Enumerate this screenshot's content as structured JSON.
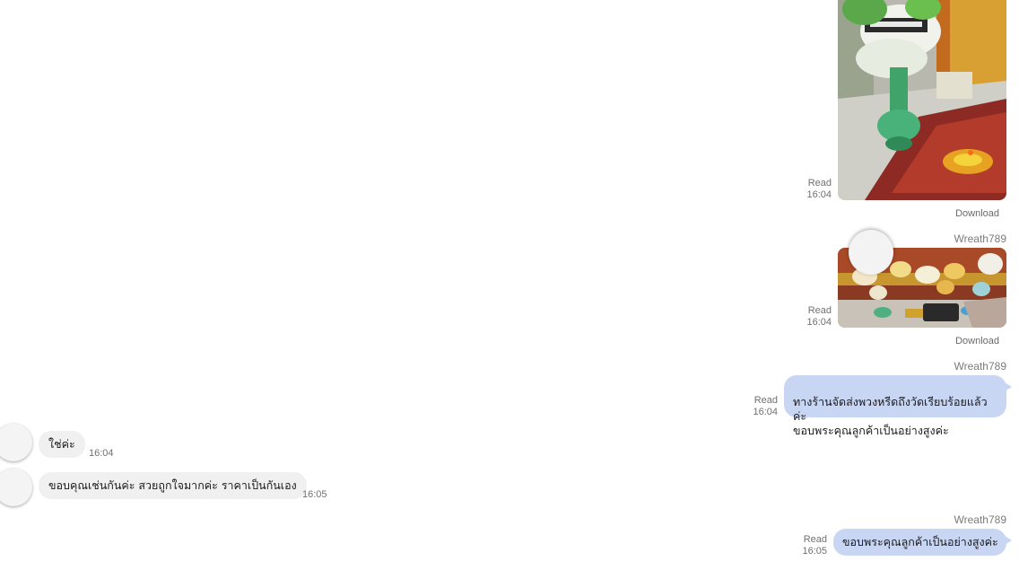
{
  "messages": {
    "img1": {
      "read": "Read",
      "time": "16:04",
      "download": "Download"
    },
    "img2": {
      "sender": "Wreath789",
      "read": "Read",
      "time": "16:04",
      "download": "Download"
    },
    "txt1": {
      "sender": "Wreath789",
      "read": "Read",
      "time": "16:04",
      "text": "ทางร้านจัดส่งพวงหรีดถึงวัดเรียบร้อยแล้วค่ะ\nขอบพระคุณลูกค้าเป็นอย่างสูงค่ะ"
    },
    "in1": {
      "text": "ใช่ค่ะ",
      "time": "16:04"
    },
    "in2": {
      "text": "ขอบคุณเช่นกันค่ะ สวยถูกใจมากค่ะ ราคาเป็นกันเอง",
      "time": "16:05"
    },
    "txt2": {
      "sender": "Wreath789",
      "read": "Read",
      "time": "16:05",
      "text": "ขอบพระคุณลูกค้าเป็นอย่างสูงค่ะ"
    }
  },
  "colors": {
    "outgoing_bubble": "#c8d6f3",
    "incoming_bubble": "#f0f0f0",
    "meta_text": "#707070"
  }
}
